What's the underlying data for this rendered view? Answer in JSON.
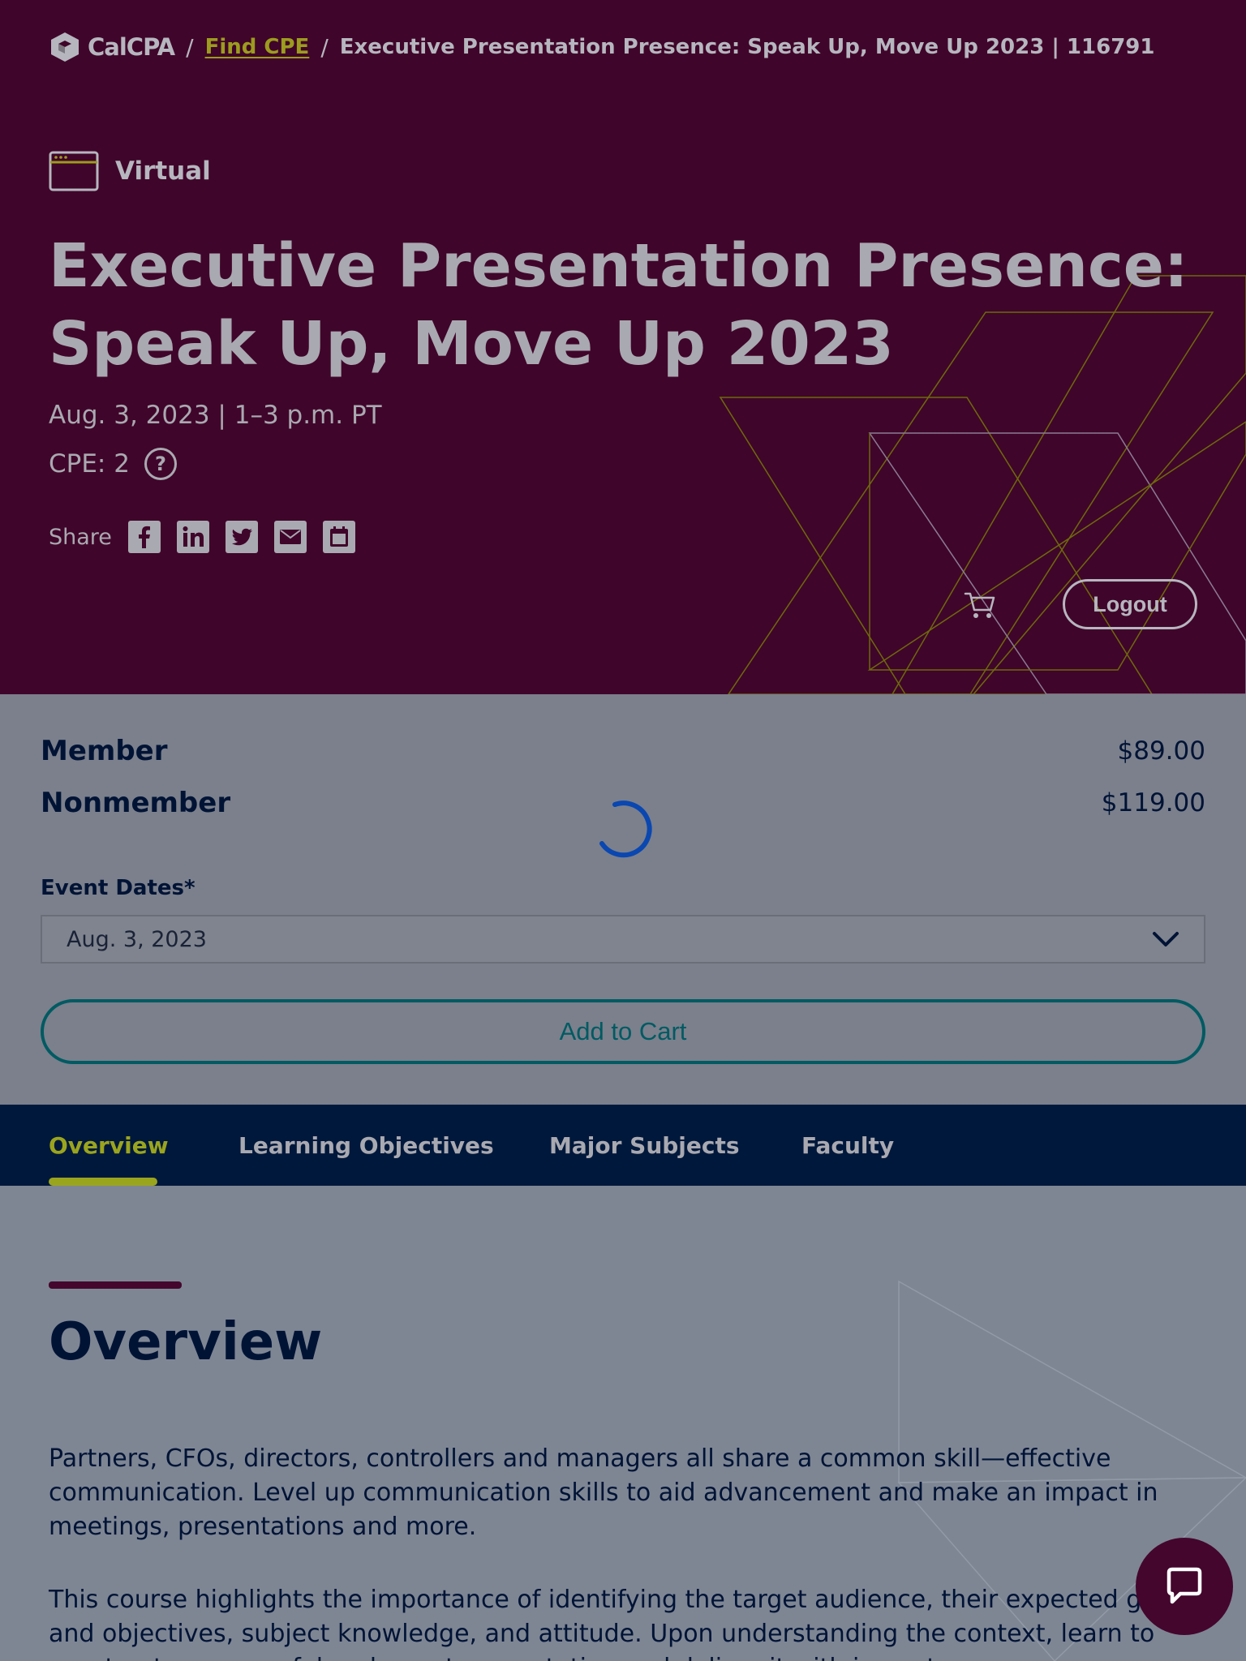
{
  "breadcrumb": {
    "logo_text": "CalCPA",
    "separator": "/",
    "link": "Find CPE",
    "current": "Executive Presentation Presence: Speak Up, Move Up 2023 | 116791"
  },
  "event": {
    "format": "Virtual",
    "title": "Executive Presentation Presence: Speak Up, Move Up 2023",
    "date_time": "Aug. 3, 2023 | 1–3 p.m. PT",
    "cpe": "CPE: 2",
    "help_symbol": "?",
    "share_label": "Share",
    "share_icons": [
      "facebook-icon",
      "linkedin-icon",
      "twitter-icon",
      "email-icon",
      "calendar-icon"
    ]
  },
  "header_actions": {
    "logout_label": "Logout"
  },
  "pricing": {
    "member_label": "Member",
    "member_price": "$89.00",
    "nonmember_label": "Nonmember",
    "nonmember_price": "$119.00",
    "dates_label": "Event Dates*",
    "selected_date": "Aug. 3, 2023",
    "add_to_cart_label": "Add to Cart"
  },
  "tabs": [
    {
      "label": "Overview",
      "active": true
    },
    {
      "label": "Learning Objectives",
      "active": false
    },
    {
      "label": "Major Subjects",
      "active": false
    },
    {
      "label": "Faculty",
      "active": false
    }
  ],
  "overview": {
    "heading": "Overview",
    "paragraph1": "Partners, CFOs, directors, controllers and managers all share a common skill—effective communication. Level up communication skills to aid advancement and make an impact in meetings, presentations and more.",
    "paragraph2": "This course highlights the importance of identifying the target audience, their expected goals and objectives, subject knowledge, and attitude. Upon understanding the context, learn to construct a purposeful and smart presentation and deliver it with impact."
  },
  "colors": {
    "hero_bg": "#40052a",
    "accent_lime": "#9aa51e",
    "navy": "#001335",
    "teal": "#005a62",
    "overlay_gray": "#7e8694"
  }
}
